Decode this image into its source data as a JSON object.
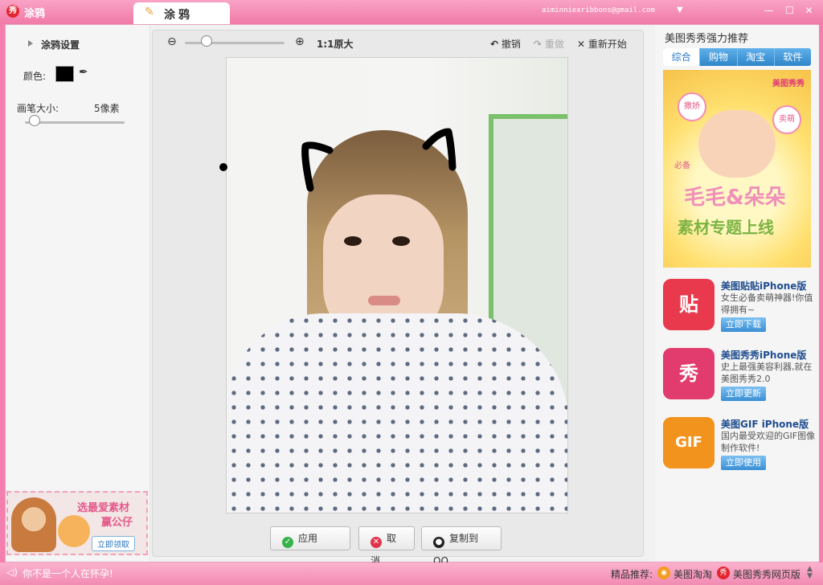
{
  "window": {
    "app_title": "涂鸦",
    "app_logo_glyph": "秀",
    "tab_label": "涂鸦",
    "account_email": "aiminniexribbons@gmail.com"
  },
  "left_panel": {
    "section_title": "涂鸦设置",
    "color_label": "颜色:",
    "brush_color": "#000000",
    "brush_size_label": "画笔大小:",
    "brush_size_value": "5像素",
    "brush_size_px": 5,
    "ad": {
      "line1": "选最爱素材",
      "line2": "赢公仔",
      "button": "立即领取"
    }
  },
  "toolbar": {
    "zoom_label": "1:1原大",
    "undo_label": "撤销",
    "redo_label": "重做",
    "restart_label": "重新开始"
  },
  "actions": {
    "apply_label": "应用",
    "cancel_label": "取消",
    "copy_label": "复制到QQ"
  },
  "right_panel": {
    "title": "美图秀秀强力推荐",
    "tabs": [
      "综合",
      "购物",
      "淘宝",
      "软件"
    ],
    "banner": {
      "brand": "美图秀秀",
      "tag1": "撒娇",
      "tag2": "卖萌",
      "tag3": "必备",
      "text1": "毛毛&朵朵",
      "text2": "素材专题上线"
    },
    "promos": [
      {
        "icon_glyph": "贴",
        "name": "美图贴贴iPhone版",
        "desc": "女生必备卖萌神器!你值得拥有~",
        "button": "立即下载",
        "color": "#e8394d"
      },
      {
        "icon_glyph": "秀",
        "name": "美图秀秀iPhone版",
        "desc": "史上最强美容利器,就在美图秀秀2.0",
        "button": "立即更新",
        "color": "#e23b6e"
      },
      {
        "icon_glyph": "GIF",
        "name": "美图GIF iPhone版",
        "desc": "国内最受欢迎的GIF图像制作软件!",
        "button": "立即使用",
        "color": "#f2931d"
      }
    ]
  },
  "statusbar": {
    "message": "你不是一个人在怀孕!",
    "rec_label": "精品推荐:",
    "rec_links": [
      "美图淘淘",
      "美图秀秀网页版"
    ]
  },
  "colors": {
    "accent_pink": "#f07aa8",
    "tab_blue": "#2f86c9"
  }
}
